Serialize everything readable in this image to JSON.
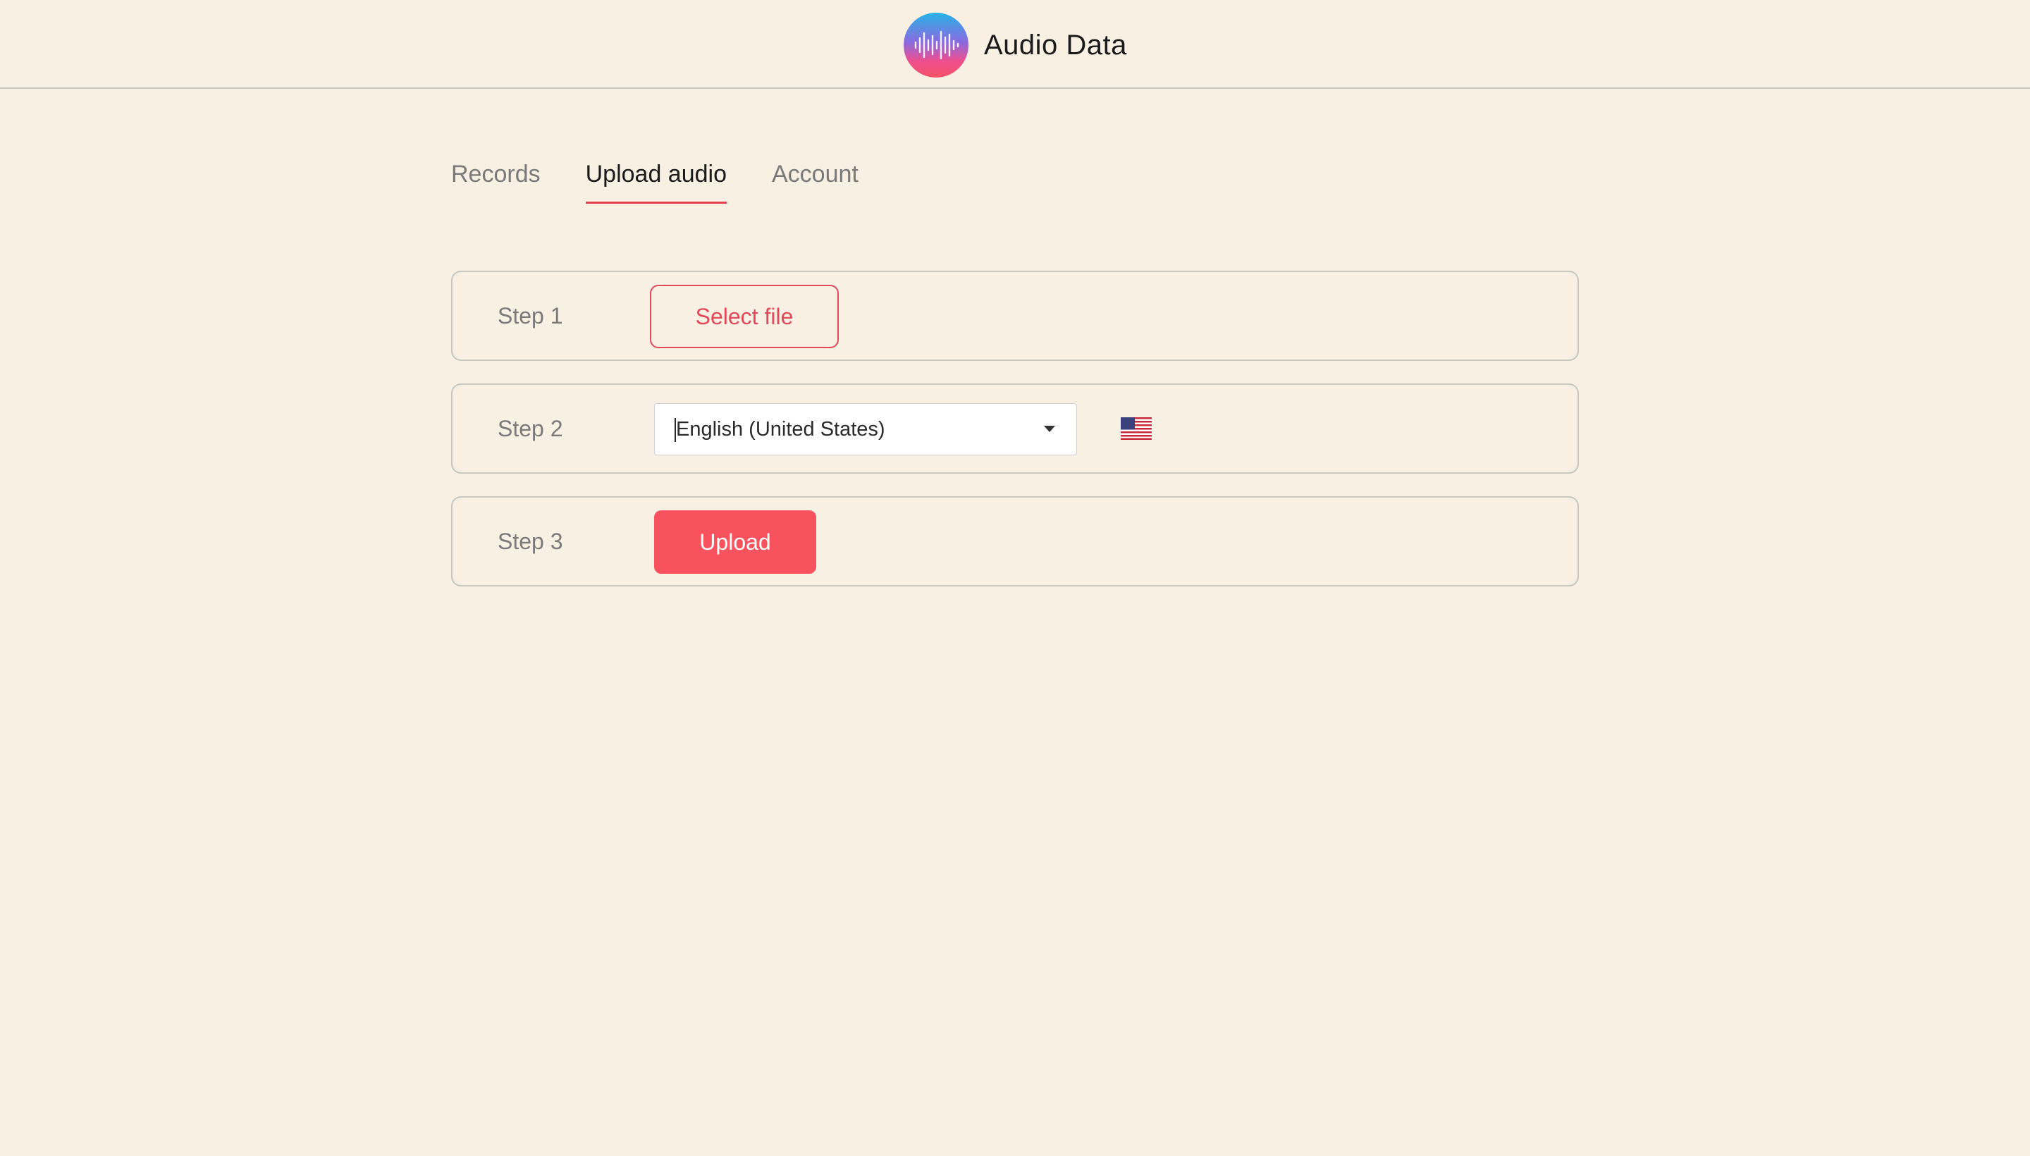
{
  "header": {
    "title": "Audio Data",
    "logo_icon": "audio-waveform-icon"
  },
  "tabs": [
    {
      "label": "Records",
      "active": false
    },
    {
      "label": "Upload audio",
      "active": true
    },
    {
      "label": "Account",
      "active": false
    }
  ],
  "steps": {
    "step1": {
      "label": "Step 1",
      "button_label": "Select file"
    },
    "step2": {
      "label": "Step 2",
      "language_selected": "English (United States)",
      "flag_icon": "us-flag-icon"
    },
    "step3": {
      "label": "Step 3",
      "button_label": "Upload"
    }
  },
  "colors": {
    "background": "#f7f0e3",
    "accent": "#f7525d",
    "accent_text": "#e2485a"
  }
}
